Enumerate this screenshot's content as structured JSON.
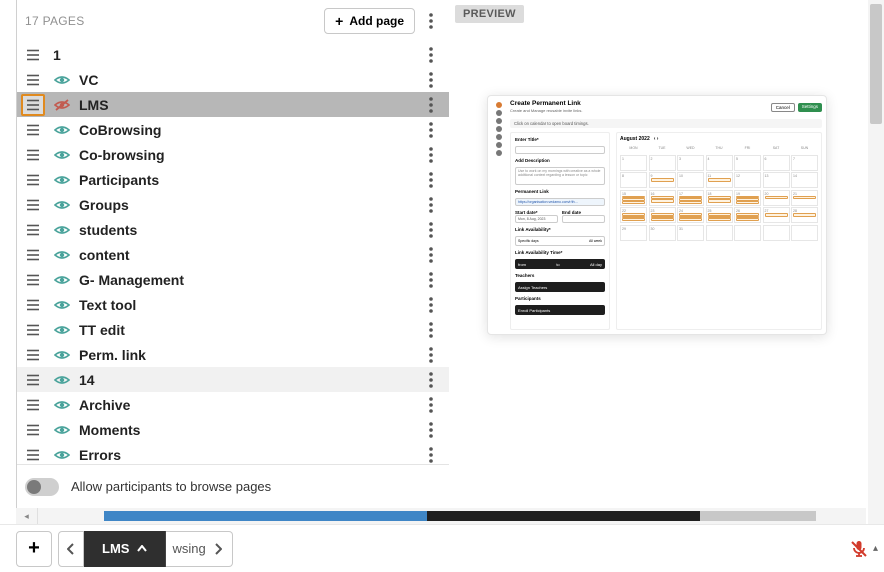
{
  "header": {
    "pages_label": "17 PAGES",
    "add_page_label": "Add page"
  },
  "pages": [
    {
      "label": "1",
      "visible": true,
      "hidden_icon": false,
      "show_eye": false
    },
    {
      "label": "VC",
      "visible": true
    },
    {
      "label": "LMS",
      "visible": false,
      "selected": true
    },
    {
      "label": "CoBrowsing",
      "visible": true
    },
    {
      "label": "Co-browsing",
      "visible": true
    },
    {
      "label": "Participants",
      "visible": true
    },
    {
      "label": "Groups",
      "visible": true
    },
    {
      "label": "students",
      "visible": true
    },
    {
      "label": "content",
      "visible": true
    },
    {
      "label": "G- Management",
      "visible": true
    },
    {
      "label": "Text tool",
      "visible": true
    },
    {
      "label": "TT edit",
      "visible": true
    },
    {
      "label": "Perm. link",
      "visible": true
    },
    {
      "label": "14",
      "visible": true,
      "highlight": true
    },
    {
      "label": "Archive",
      "visible": true
    },
    {
      "label": "Moments",
      "visible": true
    },
    {
      "label": "Errors",
      "visible": true
    }
  ],
  "allow_browse": {
    "label": "Allow participants to browse pages",
    "enabled": false
  },
  "preview": {
    "badge": "PREVIEW",
    "title": "Create Permanent Link",
    "subtitle": "Create and Manage reusable invite links.",
    "crumb": "Click on calendar to open board timings.",
    "cancel": "Cancel",
    "save": "Settings",
    "form": {
      "title_label": "Enter Title*",
      "desc_label": "Add Description",
      "desc_placeholder": "Use to work on my mornings with creative as a whole additional context regarding a lesson or topic",
      "perm_label": "Permanent Link",
      "perm_url": "https://organisation.vedamo.com/r/th…",
      "start_label": "Start date*",
      "end_label": "End date",
      "start_value": "Mon, 8 Aug, 2023",
      "availability_label": "Link Availability*",
      "avail_specific": "Specific days",
      "avail_allweek": "All week",
      "time_label": "Link Availability Time*",
      "time_from": "from",
      "time_to": "to",
      "time_allday": "All day",
      "teachers_label": "Teachers",
      "assign_teacher": "Assign Teachers",
      "participants_label": "Participants",
      "enroll": "Enroll Participants"
    },
    "calendar": {
      "month": "August 2022",
      "dow": [
        "MON",
        "TUE",
        "WED",
        "THU",
        "FRI",
        "SAT",
        "SUN"
      ]
    }
  },
  "bottom": {
    "current_tab": "LMS",
    "next_tab_partial": "wsing"
  },
  "colors": {
    "accent_orange": "#e08a1f",
    "eye_teal": "#4aa39b",
    "eye_off": "#c25b50",
    "mic_red": "#d23b2c",
    "green_btn": "#2f8f4f",
    "timeline_blue": "#3f86c6",
    "timeline_dark": "#1f1f1f"
  }
}
